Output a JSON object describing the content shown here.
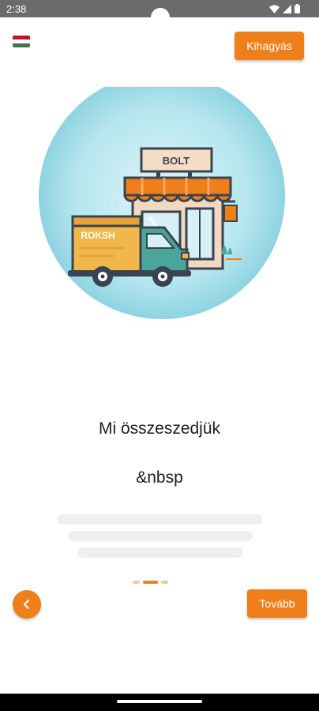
{
  "status_bar": {
    "time": "2:38",
    "icons": [
      "wifi-icon",
      "signal-icon",
      "battery-icon"
    ]
  },
  "header": {
    "language_flag": "hungary-flag-icon",
    "skip_label": "Kihagyás"
  },
  "illustration": {
    "store_sign": "BOLT",
    "truck_label": "ROKSH"
  },
  "content": {
    "title": "Mi összeszedjük",
    "subtitle": "&nbsp"
  },
  "pager": {
    "pages": 3,
    "active_index": 1
  },
  "footer": {
    "back_icon": "chevron-left-icon",
    "next_label": "Tovább"
  },
  "colors": {
    "accent": "#ef7f1a",
    "accent_light": "#f6c99c",
    "circle": "#a9dfea",
    "flag": [
      "#c8102e",
      "#ffffff",
      "#477050"
    ]
  }
}
